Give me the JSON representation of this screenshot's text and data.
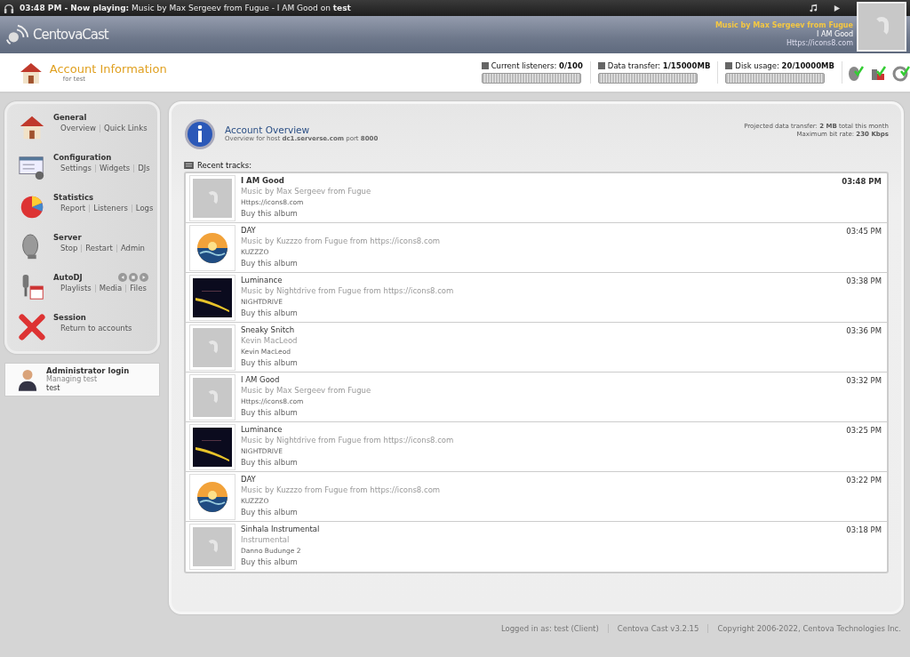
{
  "now_playing": {
    "time": "03:48 PM",
    "label": "- Now playing:",
    "text": "Music by Max Sergeev from Fugue - I AM Good on",
    "station": "test"
  },
  "brand": "CentovaCast",
  "current_track": {
    "artist": "Music by Max Sergeev from Fugue",
    "title": "I AM Good",
    "url": "Https://icons8.com"
  },
  "page_title": {
    "title": "Account Information",
    "subtitle": "for test"
  },
  "meters": [
    {
      "label": "Current listeners:",
      "value": "0/100",
      "level": 0
    },
    {
      "label": "Data transfer:",
      "value": "1/15000MB",
      "level": 0
    },
    {
      "label": "Disk usage:",
      "value": "20/10000MB",
      "level": 0
    }
  ],
  "sidebar": [
    {
      "kind": "house",
      "title": "General",
      "links": [
        "Overview",
        "Quick Links"
      ]
    },
    {
      "kind": "config",
      "title": "Configuration",
      "links": [
        "Settings",
        "Widgets",
        "DJs"
      ]
    },
    {
      "kind": "pie",
      "title": "Statistics",
      "links": [
        "Report",
        "Listeners",
        "Logs"
      ]
    },
    {
      "kind": "dish",
      "title": "Server",
      "links": [
        "Stop",
        "Restart",
        "Admin"
      ]
    },
    {
      "kind": "mic",
      "title": "AutoDJ",
      "links": [
        "Playlists",
        "Media",
        "Files"
      ]
    },
    {
      "kind": "cross",
      "title": "Session",
      "links": [
        "Return to accounts"
      ]
    }
  ],
  "admin": {
    "title": "Administrator login",
    "subtitle": "Managing test",
    "user": "test"
  },
  "overview": {
    "title": "Account Overview",
    "host_prefix": "Overview for host",
    "host": "dc1.serverse.com",
    "port_label": "port",
    "port": "8000",
    "projected_label": "Projected data transfer:",
    "projected": "2 MB",
    "projected_suffix": "total this month",
    "bitrate_label": "Maximum bit rate:",
    "bitrate": "230 Kbps"
  },
  "recent_label": "Recent tracks:",
  "tracks": [
    {
      "kind": "placeholder",
      "current": true,
      "title": "I AM Good",
      "artist": "Music by Max Sergeev from Fugue",
      "album": "Https://icons8.com",
      "buy": "Buy this album",
      "time": "03:48 PM"
    },
    {
      "kind": "picture",
      "current": false,
      "title": "DAY",
      "artist": "Music by Kuzzzo from Fugue from https://icons8.com",
      "album": "KUZZZO",
      "buy": "Buy this album",
      "time": "03:45 PM"
    },
    {
      "kind": "picture",
      "current": false,
      "title": "Luminance",
      "artist": "Music by Nightdrive from Fugue from https://icons8.com",
      "album": "NIGHTDRIVE",
      "buy": "Buy this album",
      "time": "03:38 PM"
    },
    {
      "kind": "placeholder",
      "current": false,
      "title": "Sneaky Snitch",
      "artist": "Kevin MacLeod",
      "album": "Kevin MacLeod",
      "buy": "Buy this album",
      "time": "03:36 PM"
    },
    {
      "kind": "placeholder",
      "current": false,
      "title": "I AM Good",
      "artist": "Music by Max Sergeev from Fugue",
      "album": "Https://icons8.com",
      "buy": "Buy this album",
      "time": "03:32 PM"
    },
    {
      "kind": "picture",
      "current": false,
      "title": "Luminance",
      "artist": "Music by Nightdrive from Fugue from https://icons8.com",
      "album": "NIGHTDRIVE",
      "buy": "Buy this album",
      "time": "03:25 PM"
    },
    {
      "kind": "picture",
      "current": false,
      "title": "DAY",
      "artist": "Music by Kuzzzo from Fugue from https://icons8.com",
      "album": "KUZZZO",
      "buy": "Buy this album",
      "time": "03:22 PM"
    },
    {
      "kind": "placeholder",
      "current": false,
      "title": "Sinhala Instrumental",
      "artist": "Instrumental",
      "album": "Danno Budunge 2",
      "buy": "Buy this album",
      "time": "03:18 PM"
    }
  ],
  "footer": [
    "Logged in as: test (Client)",
    "Centova Cast v3.2.15",
    "Copyright 2006-2022, Centova Technologies Inc."
  ]
}
